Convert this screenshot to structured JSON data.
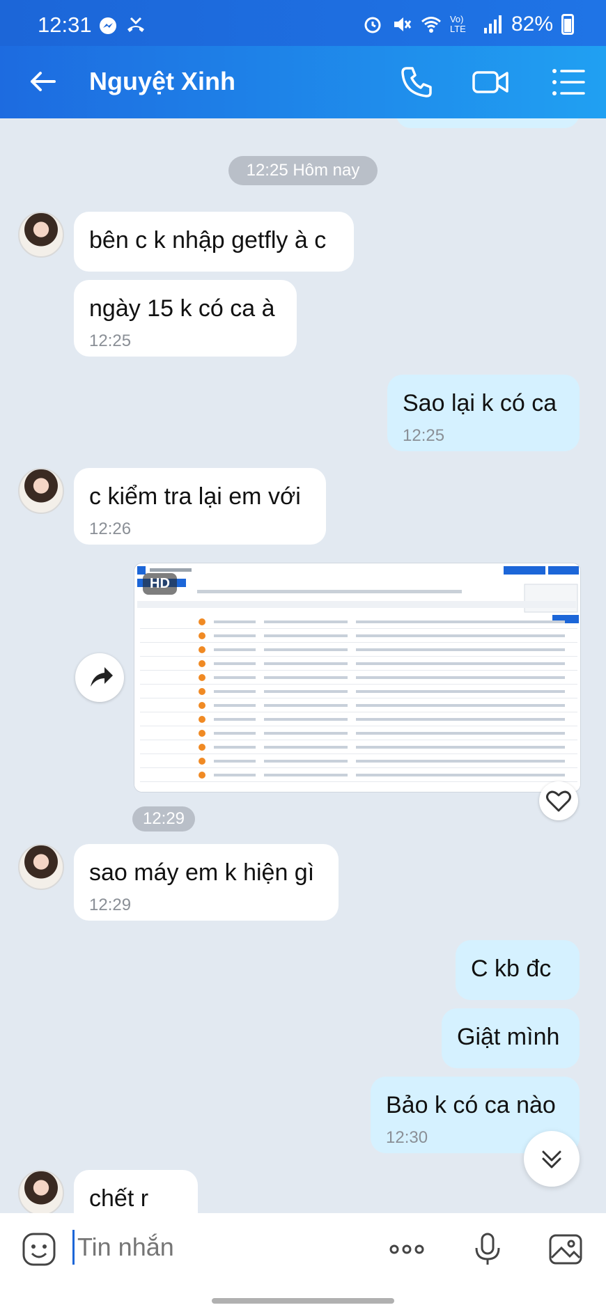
{
  "status": {
    "time": "12:31",
    "battery": "82%",
    "network": "Vo) LTE"
  },
  "header": {
    "contact_name": "Nguyệt Xinh"
  },
  "chat": {
    "date_chip": "12:25 Hôm nay",
    "image_time_chip": "12:29",
    "image_badge": "HD",
    "messages": [
      {
        "text": "bên c k nhập getfly à c",
        "time": ""
      },
      {
        "text": "ngày 15 k có ca à",
        "time": "12:25"
      },
      {
        "text": "Sao lại k có ca",
        "time": "12:25"
      },
      {
        "text": "c kiểm tra lại em với",
        "time": "12:26"
      },
      {
        "text": "sao máy em k hiện gì",
        "time": "12:29"
      },
      {
        "text": "C kb đc",
        "time": ""
      },
      {
        "text": "Giật mình",
        "time": ""
      },
      {
        "text": "Bảo k có ca nào",
        "time": "12:30"
      },
      {
        "text": "chết r",
        "time": ""
      }
    ]
  },
  "input": {
    "placeholder": "Tin nhắn"
  },
  "colors": {
    "primary": "#1c66d8",
    "my_bubble": "#d5f1ff",
    "chat_bg": "#e2e9f1"
  }
}
